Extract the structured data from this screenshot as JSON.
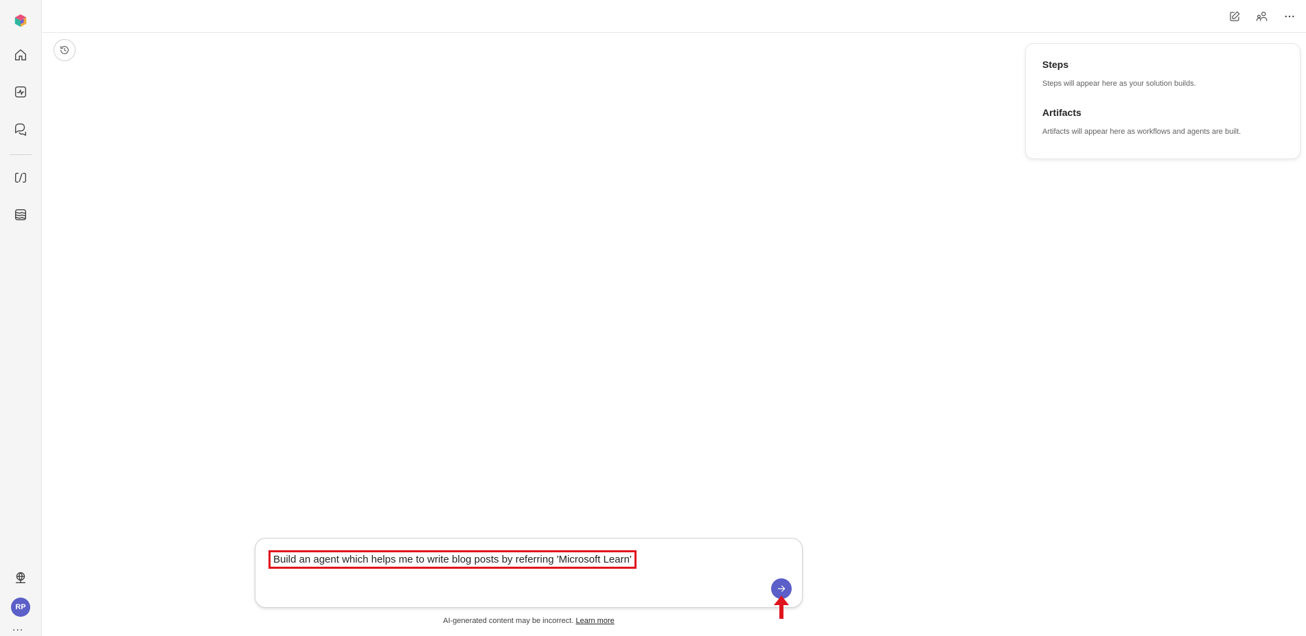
{
  "rail": {
    "avatar_initials": "RP",
    "more": "..."
  },
  "panel": {
    "steps_title": "Steps",
    "steps_text": "Steps will appear here as your solution builds.",
    "artifacts_title": "Artifacts",
    "artifacts_text": "Artifacts will appear here as workflows and agents are built."
  },
  "composer": {
    "prompt": "Build an agent which helps me to write blog posts by referring 'Microsoft Learn'"
  },
  "footer": {
    "disclaimer": "AI-generated content may be incorrect.",
    "learn_more": "Learn more"
  },
  "colors": {
    "accent": "#5b5fc7",
    "highlight": "#e0141e"
  }
}
